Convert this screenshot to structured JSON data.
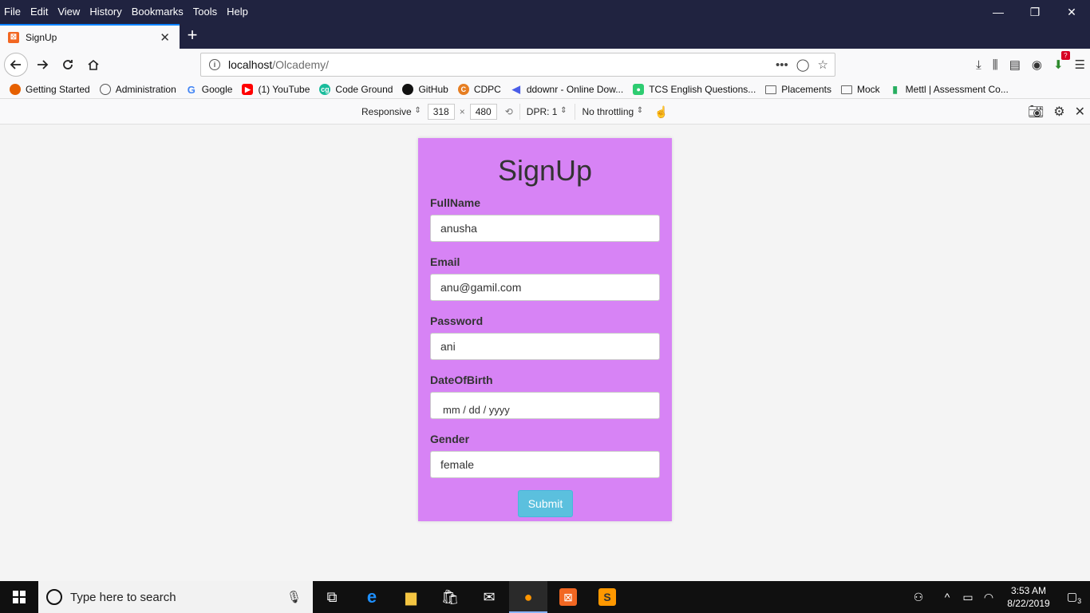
{
  "menu": [
    "File",
    "Edit",
    "View",
    "History",
    "Bookmarks",
    "Tools",
    "Help"
  ],
  "tab": {
    "title": "SignUp",
    "favicon_icon": "xampp-icon"
  },
  "url": {
    "host": "localhost",
    "path": "/Olcademy/"
  },
  "bookmarks": [
    {
      "label": "Getting Started",
      "icon": "firefox-icon",
      "color": "#e66000"
    },
    {
      "label": "Administration",
      "icon": "globe-icon",
      "color": "#555555"
    },
    {
      "label": "Google",
      "icon": "google-icon",
      "color": "#4285f4"
    },
    {
      "label": "(1) YouTube",
      "icon": "youtube-icon",
      "color": "#ff0000"
    },
    {
      "label": "Code Ground",
      "icon": "codeground-icon",
      "color": "#1abc9c"
    },
    {
      "label": "GitHub",
      "icon": "github-icon",
      "color": "#111111"
    },
    {
      "label": "CDPC",
      "icon": "cdpc-icon",
      "color": "#e67e22"
    },
    {
      "label": "ddownr - Online Dow...",
      "icon": "ddownr-icon",
      "color": "#4a5de8"
    },
    {
      "label": "TCS English Questions...",
      "icon": "tcs-icon",
      "color": "#2ecc71"
    },
    {
      "label": "Placements",
      "icon": "folder-icon",
      "color": "#777777"
    },
    {
      "label": "Mock",
      "icon": "folder-icon",
      "color": "#777777"
    },
    {
      "label": "Mettl | Assessment Co...",
      "icon": "mettl-icon",
      "color": "#27ae60"
    }
  ],
  "rdm": {
    "device": "Responsive",
    "width": "318",
    "height": "480",
    "times": "×",
    "dpr": "DPR: 1",
    "throttling": "No throttling"
  },
  "form": {
    "title": "SignUp",
    "fields": [
      {
        "label": "FullName",
        "value": "anusha"
      },
      {
        "label": "Email",
        "value": "anu@gamil.com"
      },
      {
        "label": "Password",
        "value": "ani"
      },
      {
        "label": "DateOfBirth",
        "value": "mm / dd / yyyy"
      },
      {
        "label": "Gender",
        "value": "female"
      }
    ],
    "submit_label": "Submit",
    "colors": {
      "background": "#d783f5",
      "button": "#5bc0de"
    }
  },
  "taskbar": {
    "search_placeholder": "Type here to search",
    "time": "3:53 AM",
    "date": "8/22/2019",
    "notifications": "3"
  }
}
